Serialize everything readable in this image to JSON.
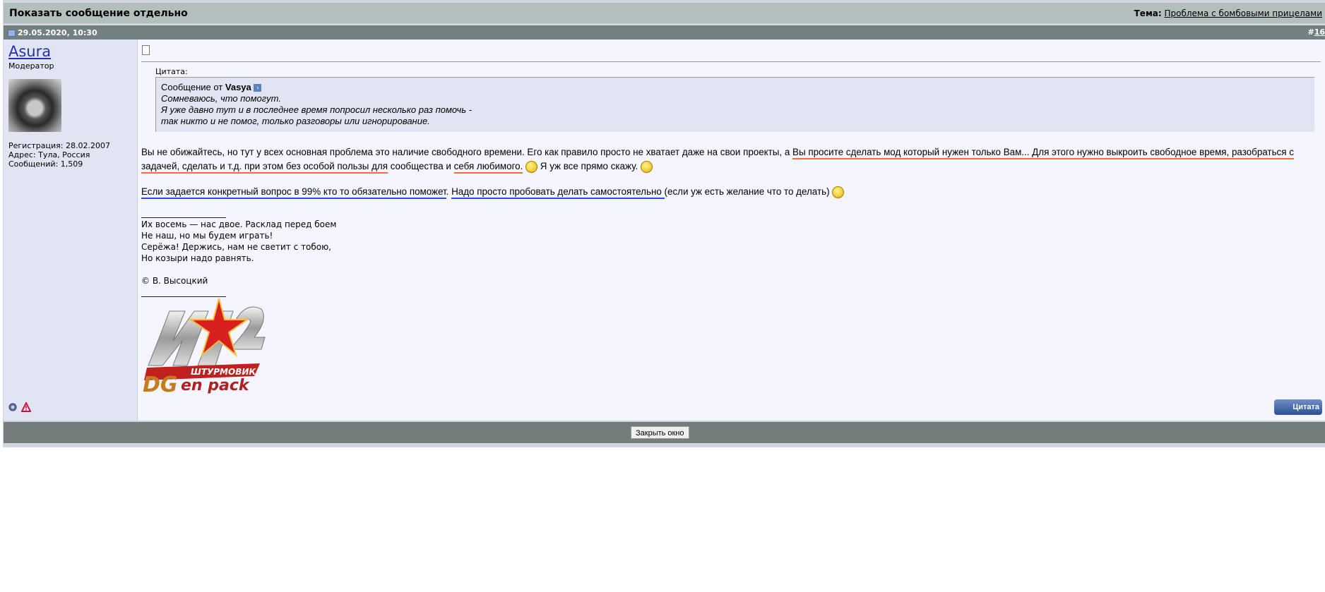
{
  "header": {
    "title": "Показать сообщение отдельно",
    "topic_label": "Тема:",
    "topic_link": "Проблема с бомбовыми прицелами"
  },
  "post": {
    "date": "29.05.2020, 10:30",
    "number_prefix": "#",
    "number": "16"
  },
  "author": {
    "name": "Asura",
    "role": "Модератор",
    "registration": "Регистрация: 28.02.2007",
    "address": "Адрес: Тула, Россия",
    "posts": "Сообщений: 1,509"
  },
  "quote": {
    "label": "Цитата:",
    "from_prefix": "Сообщение от",
    "from_user": "Vasya",
    "lines": [
      "Сомневаюсь, что помогут.",
      "Я уже давно тут и в последнее время попросил несколько раз помочь -",
      "так никто и не помог, только разговоры или игнорирование."
    ]
  },
  "message": {
    "p1_a": "Вы не обижайтесь, но тут у всех основная проблема это наличие свободного времени. Его как правило просто не хватает даже на свои проекты, а ",
    "p1_u1": "Вы просите сделать мод который нужен только Вам... Для этого нужно выкроить свободное время, разобраться с задачей, сделать и т.д. при этом без особой пользы для",
    "p1_b": " сообщества и ",
    "p1_u2": "себя любимого.",
    "p1_c": " Я уж все прямо скажу.",
    "p2_u1": "Если задается конкретный вопрос в 99% кто то обязательно поможет",
    "p2_a": ". ",
    "p2_u2": "Надо просто пробовать делать самостоятельно ",
    "p2_b": "(если уж есть желание что то делать)"
  },
  "signature": {
    "rule": "____________________",
    "lines": [
      "Их восемь — нас двое. Расклад перед боем",
      "Не наш, но мы будем играть!",
      "Серёжа! Держись, нам не светит с тобою,",
      "Но козыри надо равнять."
    ],
    "credit": "© В. Высоцкий",
    "logo_text": [
      "ИЛ-2",
      "ШТУРМОВИК",
      "DGen pack"
    ]
  },
  "buttons": {
    "quote": "Цитата",
    "close": "Закрыть окно"
  }
}
